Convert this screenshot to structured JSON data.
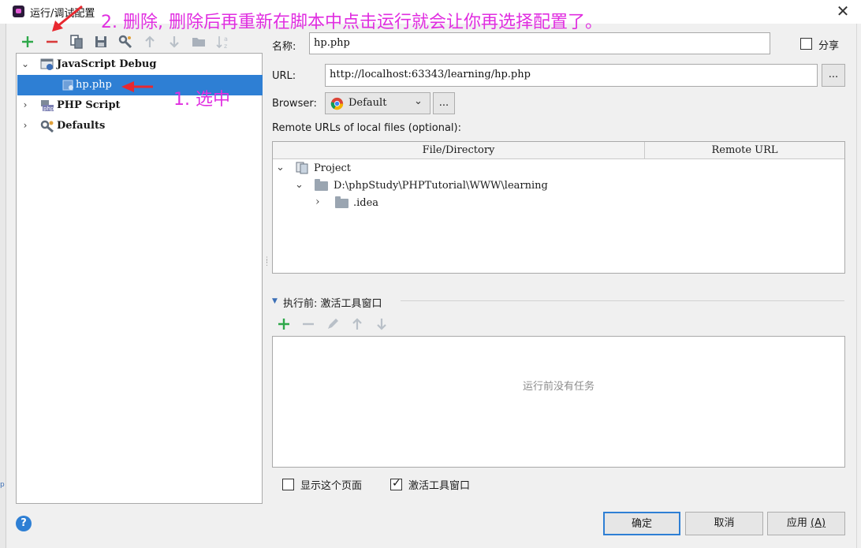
{
  "window": {
    "title": "运行/调试配置",
    "close_glyph": "✕",
    "edge_fragment": "p"
  },
  "toolbar": {
    "icons": [
      "add-icon",
      "remove-icon",
      "copy-icon",
      "save-icon",
      "edit-defaults-icon",
      "move-up-icon",
      "move-down-icon",
      "folder-icon",
      "sort-icon"
    ],
    "add_color": "#2ea84a",
    "remove_color": "#d93a3a"
  },
  "tree": {
    "items": [
      {
        "label": "JavaScript Debug",
        "expanded": true,
        "icon": "javascript-debug-icon"
      },
      {
        "label": "hp.php",
        "selected": true,
        "icon": "config-file-icon"
      },
      {
        "label": "PHP Script",
        "expanded": false,
        "icon": "php-script-icon"
      },
      {
        "label": "Defaults",
        "expanded": false,
        "icon": "wrench-icon"
      }
    ],
    "selection_color": "#2e7fd4"
  },
  "form": {
    "name_label": "名称:",
    "name_value": "hp.php",
    "share_label": "分享",
    "share_checked": false,
    "url_label": "URL:",
    "url_value": "http://localhost:63343/learning/hp.php",
    "url_browse": "...",
    "browser_label": "Browser:",
    "browser_value": "Default",
    "browser_browse": "...",
    "remote_label": "Remote URLs of local files (optional):"
  },
  "remote_table": {
    "columns": [
      "File/Directory",
      "Remote URL"
    ],
    "rows": [
      {
        "label": "Project",
        "arrow": "⌄"
      },
      {
        "label": "D:\\phpStudy\\PHPTutorial\\WWW\\learning",
        "arrow": "⌄"
      },
      {
        "label": ".idea",
        "arrow": "›"
      }
    ]
  },
  "before_launch": {
    "title": "执行前: 激活工具窗口",
    "empty_text": "运行前没有任务",
    "icons": [
      "add-icon",
      "remove-icon",
      "edit-icon",
      "move-up-icon",
      "move-down-icon"
    ]
  },
  "checkboxes": {
    "show_page_label": "显示这个页面",
    "show_page_checked": false,
    "activate_label": "激活工具窗口",
    "activate_checked": true
  },
  "buttons": {
    "ok": "确定",
    "cancel": "取消",
    "apply": "应用",
    "apply_mnemonic": "(A)",
    "help": "?"
  },
  "annotations": {
    "step1": "1. 选中",
    "step2": "2. 删除, 删除后再重新在脚本中点击运行就会让你再选择配置了。",
    "color": "#e02ee0",
    "arrow_color": "#e8282f"
  }
}
